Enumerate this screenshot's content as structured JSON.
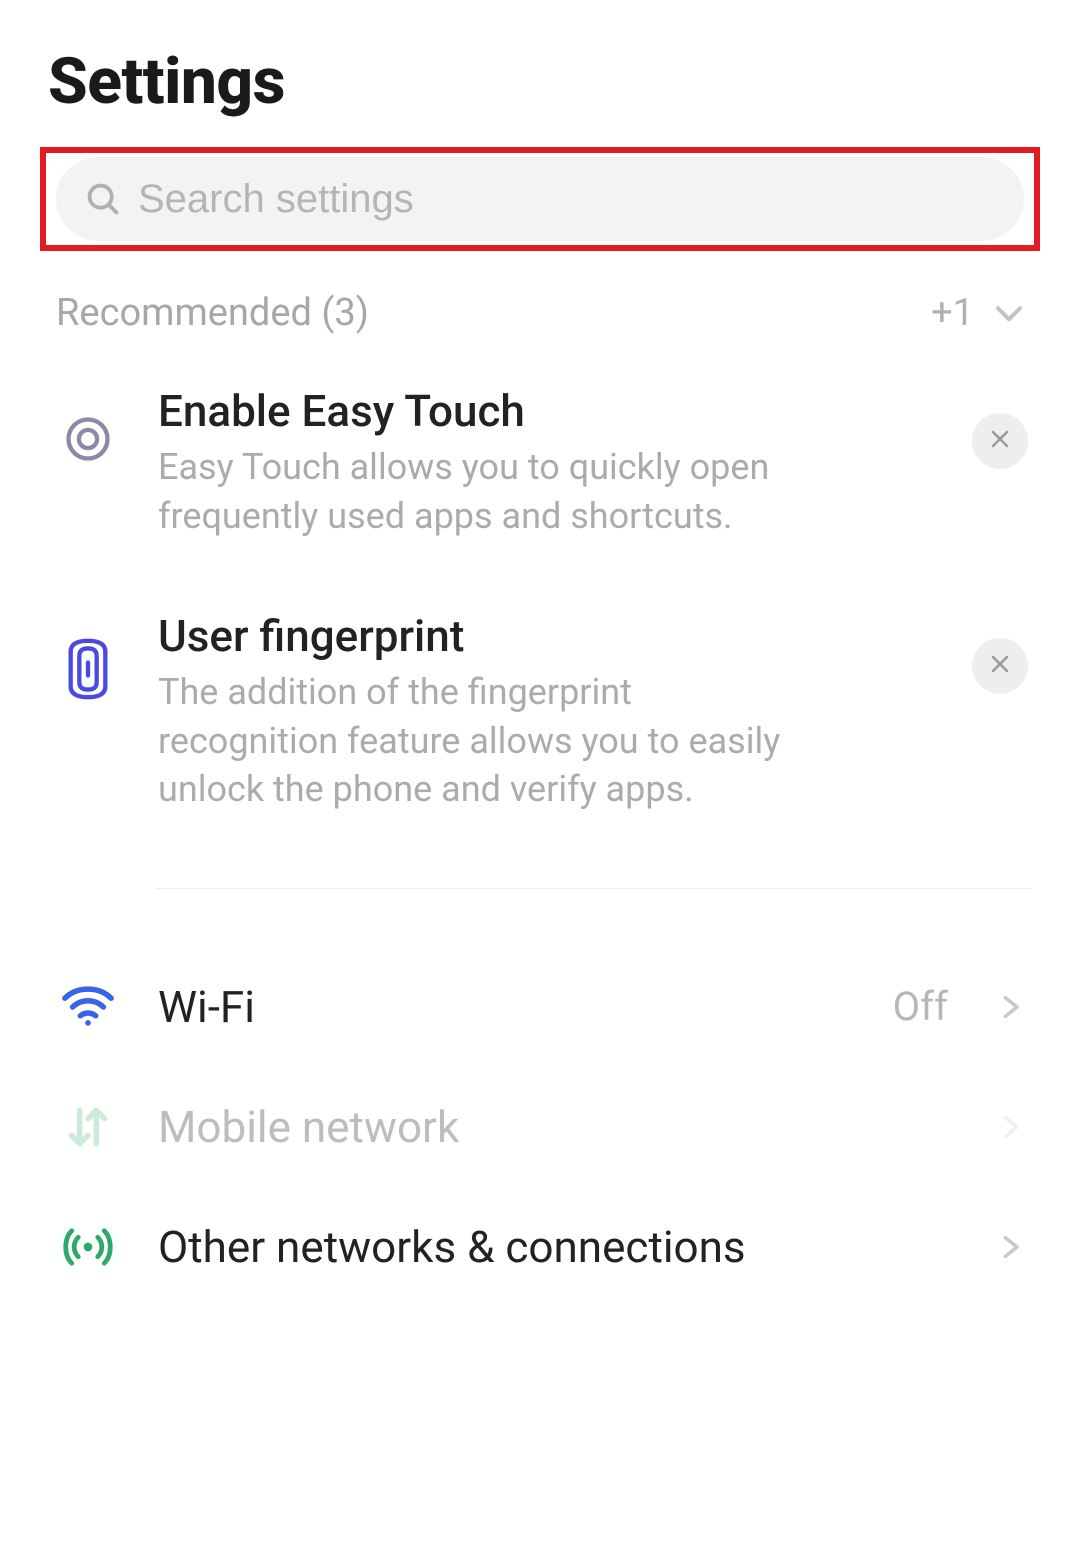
{
  "header": {
    "title": "Settings"
  },
  "search": {
    "placeholder": "Search settings",
    "value": ""
  },
  "recommended": {
    "label": "Recommended (3)",
    "extra_count": "+1",
    "items": [
      {
        "title": "Enable Easy Touch",
        "description": "Easy Touch allows you to quickly open frequently used apps and shortcuts.",
        "icon": "target-icon"
      },
      {
        "title": "User fingerprint",
        "description": "The addition of the fingerprint recognition feature allows you to easily unlock the phone and verify apps.",
        "icon": "fingerprint-icon"
      }
    ]
  },
  "settings": {
    "items": [
      {
        "label": "Wi-Fi",
        "status": "Off",
        "icon": "wifi-icon",
        "disabled": false
      },
      {
        "label": "Mobile network",
        "status": "",
        "icon": "mobile-data-icon",
        "disabled": true
      },
      {
        "label": "Other networks & connections",
        "status": "",
        "icon": "broadcast-icon",
        "disabled": false
      }
    ]
  }
}
